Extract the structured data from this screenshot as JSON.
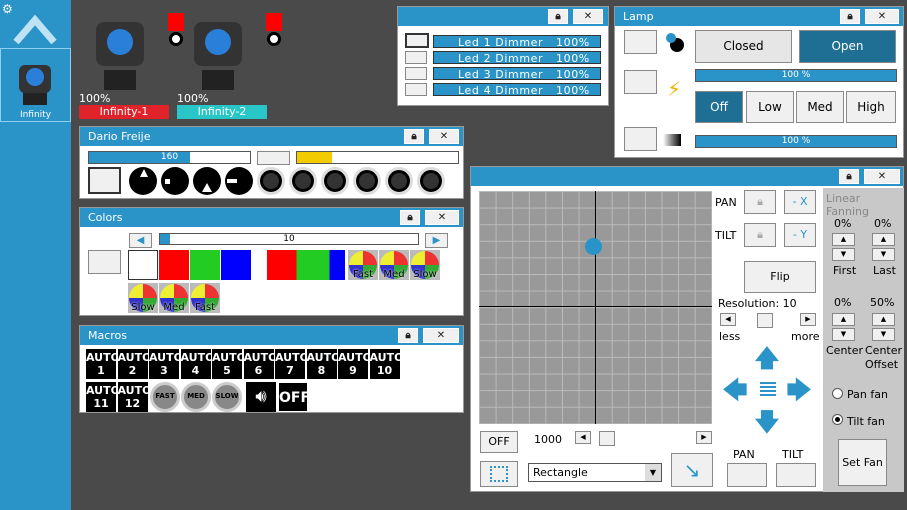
{
  "sidebar": {
    "tab_label": "Infinity"
  },
  "fixtures": [
    {
      "percent": "100%",
      "name": "Infinity-1",
      "color": "#e0232a"
    },
    {
      "percent": "100%",
      "name": "Infinity-2",
      "color": "#28c6c6"
    }
  ],
  "led": {
    "rows": [
      {
        "name": "Led 1 Dimmer",
        "value": "100%"
      },
      {
        "name": "Led 2 Dimmer",
        "value": "100%"
      },
      {
        "name": "Led 3 Dimmer",
        "value": "100%"
      },
      {
        "name": "Led 4 Dimmer",
        "value": "100%"
      }
    ]
  },
  "lamp": {
    "title": "Lamp",
    "closed": "Closed",
    "open": "Open",
    "bar1": "100 %",
    "off": "Off",
    "low": "Low",
    "med": "Med",
    "high": "High",
    "bar2": "100 %"
  },
  "dario": {
    "title": "Dario Freije",
    "slider1": "160",
    "slider1_fraction": 0.63
  },
  "colors": {
    "title": "Colors",
    "slider": "10",
    "labels": [
      "Fast",
      "Med",
      "Slow",
      "Slow",
      "Med",
      "Fast"
    ]
  },
  "macros": {
    "title": "Macros",
    "auto_word": "AUTO",
    "numbers": [
      "1",
      "2",
      "3",
      "4",
      "5",
      "6",
      "7",
      "8",
      "9",
      "10",
      "11",
      "12"
    ],
    "fx": [
      "FAST",
      "MED",
      "SLOW"
    ],
    "off": "OFF"
  },
  "pantilt": {
    "pan": "PAN",
    "tilt": "TILT",
    "minus_x": "- X",
    "minus_y": "- Y",
    "flip": "Flip",
    "resolution": "Resolution: 10",
    "less": "less",
    "more": "more",
    "off": "OFF",
    "speed": "1000",
    "shape": "Rectangle",
    "pan_btn": "PAN",
    "tilt_btn": "TILT"
  },
  "fanning": {
    "title": "Linear Fanning",
    "first_pct": "0%",
    "last_pct": "0%",
    "first": "First",
    "last": "Last",
    "center_pct": "0%",
    "offset_pct": "50%",
    "center": "Center",
    "center_offset_1": "Center",
    "center_offset_2": "Offset",
    "pan_fan": "Pan fan",
    "tilt_fan": "Tilt fan",
    "set_fan": "Set Fan"
  },
  "colors_theme": {
    "accent": "#2a93c8"
  }
}
